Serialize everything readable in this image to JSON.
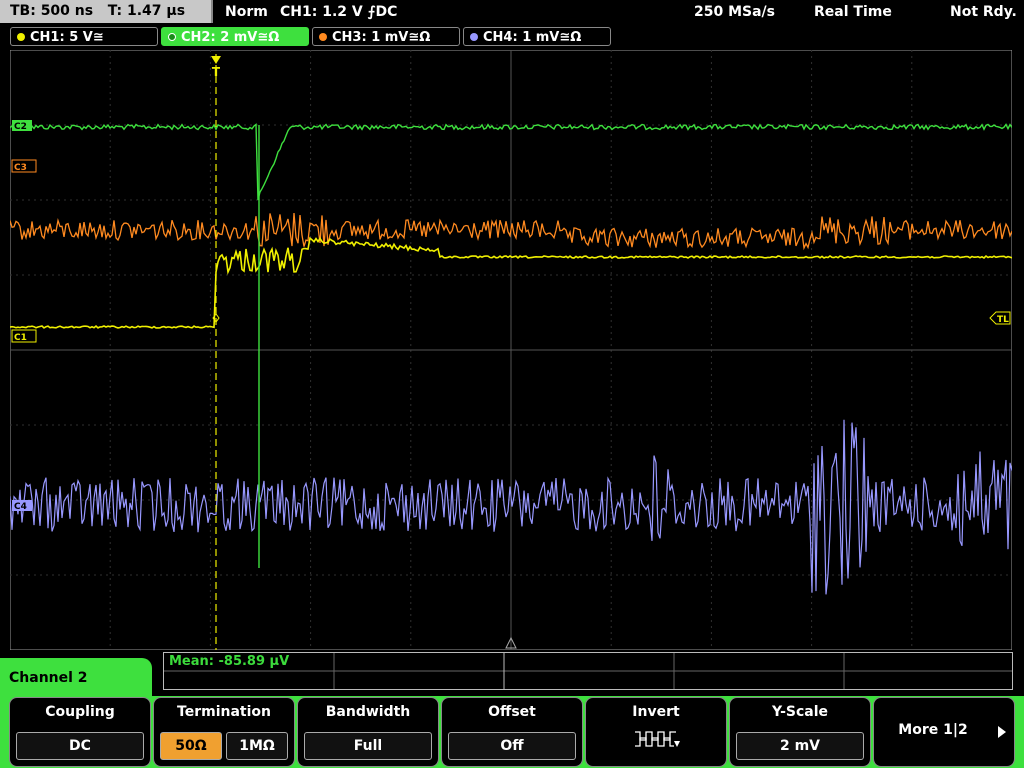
{
  "status": {
    "timebase": "TB: 500 ns",
    "trigger_time": "T: 1.47 µs",
    "mode": "Norm",
    "trigger": "CH1: 1.2 V ⨍DC",
    "sample_rate": "250 MSa/s",
    "acq": "Real Time",
    "ready": "Not Rdy."
  },
  "channels": [
    {
      "label": "CH1: 5 V≅",
      "color": "#f0f000"
    },
    {
      "label": "CH2: 2 mV≅Ω",
      "color": "#3ee03e"
    },
    {
      "label": "CH3: 1 mV≅Ω",
      "color": "#ff8a20"
    },
    {
      "label": "CH4: 1 mV≅Ω",
      "color": "#9898ff"
    }
  ],
  "markers": {
    "c1": "C1",
    "c2": "C2",
    "c3": "C3",
    "c4": "C4",
    "tl": "TL",
    "trigger": "T"
  },
  "measurement": {
    "mean": "Mean: -85.89 µV"
  },
  "menu": {
    "channel_label": "Channel 2",
    "coupling": {
      "title": "Coupling",
      "value": "DC"
    },
    "termination": {
      "title": "Termination",
      "opt1": "50Ω",
      "opt2": "1MΩ"
    },
    "bandwidth": {
      "title": "Bandwidth",
      "value": "Full"
    },
    "offset": {
      "title": "Offset",
      "value": "Off"
    },
    "invert": {
      "title": "Invert"
    },
    "yscale": {
      "title": "Y-Scale",
      "value": "2 mV"
    },
    "more": {
      "label": "More 1|2"
    }
  }
}
